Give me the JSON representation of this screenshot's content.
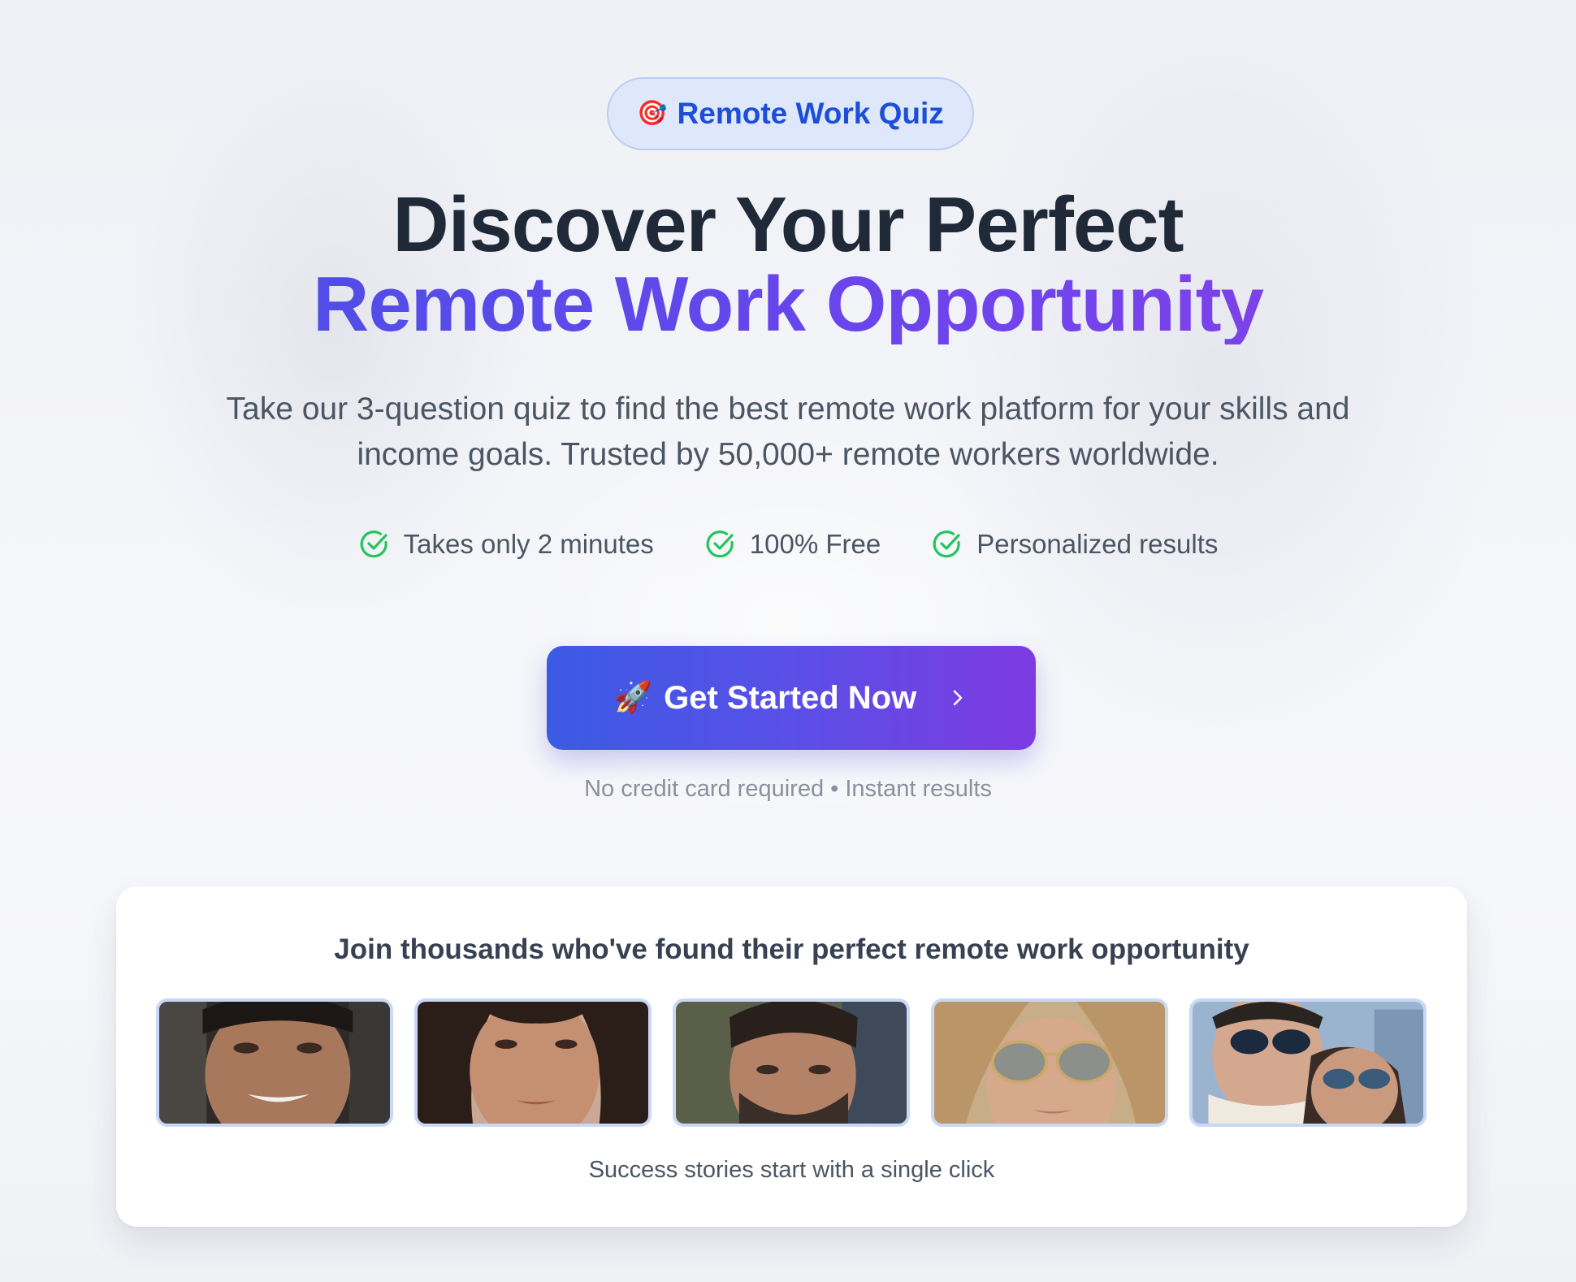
{
  "badge": {
    "icon": "🎯",
    "label": "Remote Work Quiz"
  },
  "hero": {
    "title_line1": "Discover Your Perfect",
    "title_line2": "Remote Work Opportunity",
    "subtitle": "Take our 3-question quiz to find the best remote work platform for your skills and income goals. Trusted by 50,000+ remote workers worldwide."
  },
  "features": [
    {
      "icon": "check-circle-icon",
      "label": "Takes only 2 minutes"
    },
    {
      "icon": "check-circle-icon",
      "label": "100% Free"
    },
    {
      "icon": "check-circle-icon",
      "label": "Personalized results"
    }
  ],
  "cta": {
    "icon": "🚀",
    "label": "Get Started Now",
    "chevron_icon": "chevron-right-icon",
    "note": "No credit card required • Instant results"
  },
  "testimonials": {
    "title": "Join thousands who've found their perfect remote work opportunity",
    "caption": "Success stories start with a single click"
  },
  "colors": {
    "accent_blue": "#1d4ed8",
    "gradient_start": "#4352e6",
    "gradient_end": "#8b3fe9",
    "check_green": "#22c55e"
  }
}
